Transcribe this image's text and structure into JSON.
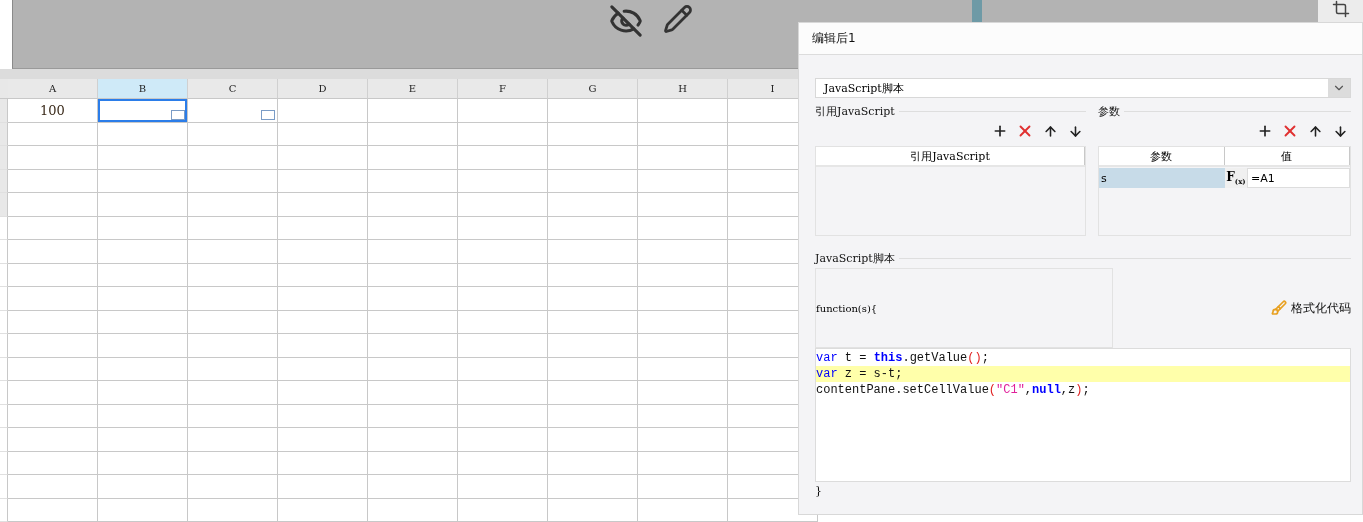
{
  "sheet": {
    "columns": [
      {
        "label": "A",
        "selected": false
      },
      {
        "label": "B",
        "selected": true
      },
      {
        "label": "C",
        "selected": false
      },
      {
        "label": "D",
        "selected": false
      },
      {
        "label": "E",
        "selected": false
      },
      {
        "label": "F",
        "selected": false
      },
      {
        "label": "G",
        "selected": false
      },
      {
        "label": "H",
        "selected": false
      },
      {
        "label": "I",
        "selected": false
      }
    ],
    "first_row": [
      {
        "text": "100",
        "selected": false,
        "widget": false
      },
      {
        "selected": true,
        "widget": true
      },
      {
        "selected": false,
        "widget": true
      }
    ]
  },
  "dialog": {
    "title": "编辑后1",
    "type_select": {
      "value": "JavaScript脚本"
    },
    "imports": {
      "title": "引用JavaScript",
      "column": "引用JavaScript"
    },
    "parameters": {
      "title": "参数",
      "columns": [
        "参数",
        "值"
      ],
      "rows": [
        {
          "name": "s",
          "formula_button": "F$_{(x)}$",
          "value": "=A1",
          "selected": true
        }
      ]
    },
    "script": {
      "title": "JavaScript脚本",
      "signature": "function(s){",
      "format_button": "格式化代码",
      "closing": "}",
      "lines": [
        {
          "highlighted": false,
          "tokens": [
            {
              "kind": "keyword",
              "text": "var"
            },
            {
              "kind": "plain",
              "text": " t = "
            },
            {
              "kind": "literal",
              "text": "this"
            },
            {
              "kind": "plain",
              "text": ".getValue"
            },
            {
              "kind": "bracket",
              "text": "()"
            },
            {
              "kind": "plain",
              "text": ";"
            }
          ]
        },
        {
          "highlighted": true,
          "tokens": [
            {
              "kind": "keyword",
              "text": "var"
            },
            {
              "kind": "plain",
              "text": " z = s-t;"
            }
          ]
        },
        {
          "highlighted": false,
          "tokens": [
            {
              "kind": "plain",
              "text": "contentPane.setCellValue"
            },
            {
              "kind": "bracket",
              "text": "("
            },
            {
              "kind": "string",
              "text": "\"C1\""
            },
            {
              "kind": "plain",
              "text": ","
            },
            {
              "kind": "literal",
              "text": "null"
            },
            {
              "kind": "plain",
              "text": ",z"
            },
            {
              "kind": "bracket",
              "text": ")"
            },
            {
              "kind": "plain",
              "text": ";"
            }
          ]
        }
      ]
    }
  }
}
